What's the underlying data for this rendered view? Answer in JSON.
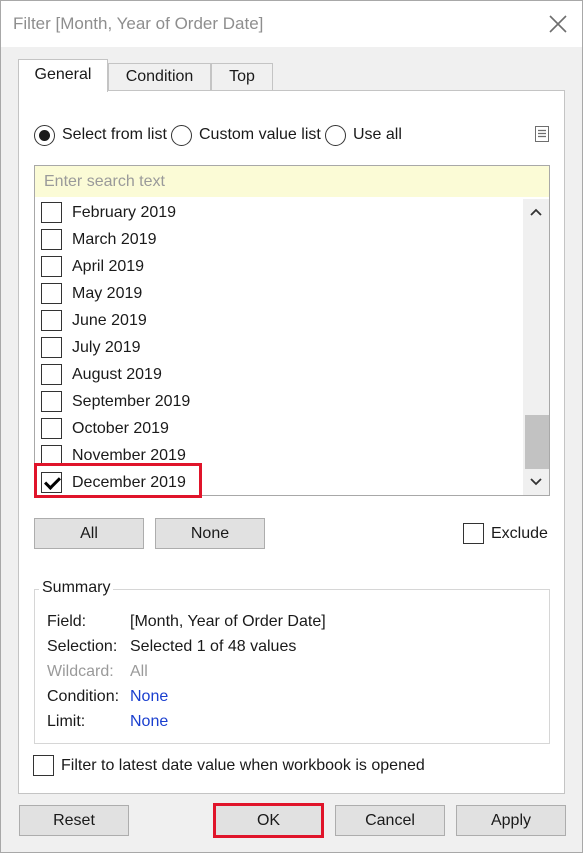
{
  "dialog": {
    "title": "Filter [Month, Year of Order Date]"
  },
  "tabs": [
    {
      "label": "General",
      "active": true
    },
    {
      "label": "Condition",
      "active": false
    },
    {
      "label": "Top",
      "active": false
    }
  ],
  "mode": {
    "options": [
      {
        "label": "Select from list",
        "selected": true
      },
      {
        "label": "Custom value list",
        "selected": false
      },
      {
        "label": "Use all",
        "selected": false
      }
    ]
  },
  "search": {
    "placeholder": "Enter search text",
    "value": ""
  },
  "list": {
    "items": [
      {
        "label": "February 2019",
        "checked": false
      },
      {
        "label": "March 2019",
        "checked": false
      },
      {
        "label": "April 2019",
        "checked": false
      },
      {
        "label": "May 2019",
        "checked": false
      },
      {
        "label": "June 2019",
        "checked": false
      },
      {
        "label": "July 2019",
        "checked": false
      },
      {
        "label": "August 2019",
        "checked": false
      },
      {
        "label": "September 2019",
        "checked": false
      },
      {
        "label": "October 2019",
        "checked": false
      },
      {
        "label": "November 2019",
        "checked": false
      },
      {
        "label": "December 2019",
        "checked": true
      }
    ]
  },
  "actions": {
    "all_label": "All",
    "none_label": "None",
    "exclude_label": "Exclude",
    "exclude_checked": false
  },
  "summary": {
    "legend": "Summary",
    "rows": [
      {
        "label": "Field:",
        "value": "[Month, Year of Order Date]",
        "style": "normal"
      },
      {
        "label": "Selection:",
        "value": "Selected 1 of 48 values",
        "style": "normal"
      },
      {
        "label": "Wildcard:",
        "value": "All",
        "style": "muted"
      },
      {
        "label": "Condition:",
        "value": "None",
        "style": "blue"
      },
      {
        "label": "Limit:",
        "value": "None",
        "style": "blue"
      }
    ]
  },
  "latest": {
    "label": "Filter to latest date value when workbook is opened",
    "checked": false
  },
  "footer": {
    "reset_label": "Reset",
    "ok_label": "OK",
    "cancel_label": "Cancel",
    "apply_label": "Apply"
  },
  "colors": {
    "highlight": "#e0142a",
    "search_bg": "#fbfbd6",
    "link_blue": "#1a3fcf"
  }
}
